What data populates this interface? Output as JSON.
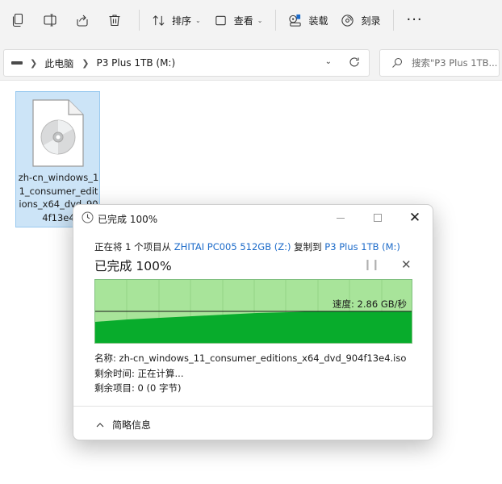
{
  "toolbar": {
    "sort_label": "排序",
    "view_label": "查看",
    "mount_label": "装载",
    "burn_label": "刻录",
    "more_label": "···"
  },
  "address": {
    "breadcrumb": [
      "此电脑",
      "P3 Plus 1TB (M:)"
    ],
    "search_placeholder": "搜索\"P3 Plus 1TB..."
  },
  "file": {
    "name": "zh-cn_windows_11_consumer_editions_x64_dvd_904f13e4"
  },
  "dialog": {
    "title": "已完成 100%",
    "copy_prefix": "正在将 1 个项目从 ",
    "source": "ZHITAI PC005 512GB (Z:)",
    "copy_mid": " 复制到 ",
    "destination": "P3 Plus 1TB (M:)",
    "status": "已完成 100%",
    "speed": "速度: 2.86 GB/秒",
    "name_line": "名称: zh-cn_windows_11_consumer_editions_x64_dvd_904f13e4.iso",
    "time_line": "剩余时间: 正在计算...",
    "items_line": "剩余项目: 0 (0 字节)",
    "details_label": "简略信息",
    "progress_percent": 100
  },
  "colors": {
    "accent": "#1b6ac9",
    "graph_bg": "#a8e49a",
    "graph_fill": "#08ac2c",
    "selection": "#cce4f7"
  }
}
